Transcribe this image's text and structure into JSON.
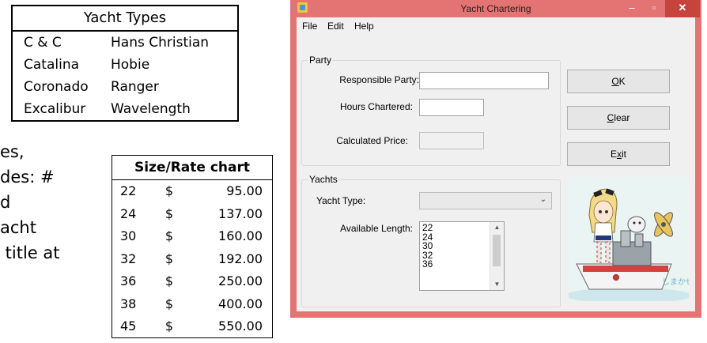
{
  "yacht_types": {
    "title": "Yacht Types",
    "rows": [
      [
        "C & C",
        "Hans Christian"
      ],
      [
        "Catalina",
        "Hobie"
      ],
      [
        "Coronado",
        "Ranger"
      ],
      [
        "Excalibur",
        "Wavelength"
      ]
    ]
  },
  "slide_text": [
    "es,",
    "des: #",
    "d",
    "acht",
    " title at"
  ],
  "rate_chart": {
    "title": "Size/Rate chart",
    "rows": [
      [
        "22",
        "$",
        "95.00"
      ],
      [
        "24",
        "$",
        "137.00"
      ],
      [
        "30",
        "$",
        "160.00"
      ],
      [
        "32",
        "$",
        "192.00"
      ],
      [
        "36",
        "$",
        "250.00"
      ],
      [
        "38",
        "$",
        "400.00"
      ],
      [
        "45",
        "$",
        "550.00"
      ]
    ]
  },
  "window": {
    "title": "Yacht Chartering",
    "accent_color": "#e47373",
    "controls": {
      "minimize": "–",
      "maximize": "▫",
      "close": "✕"
    }
  },
  "menu": {
    "file": "File",
    "edit": "Edit",
    "help": "Help"
  },
  "party": {
    "group_title": "Party",
    "responsible_label": "Responsible Party:",
    "responsible_value": "",
    "hours_label": "Hours Chartered:",
    "hours_value": "",
    "price_label": "Calculated Price:",
    "price_value": ""
  },
  "yachts": {
    "group_title": "Yachts",
    "type_label": "Yacht Type:",
    "type_value": "",
    "length_label": "Available Length:",
    "lengths": [
      "22",
      "24",
      "30",
      "32",
      "36"
    ]
  },
  "buttons": {
    "ok_mnemonic": "O",
    "ok_rest": "K",
    "clear_mnemonic": "C",
    "clear_rest": "lear",
    "exit_pre": "E",
    "exit_mnemonic": "x",
    "exit_rest": "it"
  },
  "picture": {
    "icon": "anime-ship-girl-illustration",
    "signature": "しまかぜ"
  }
}
